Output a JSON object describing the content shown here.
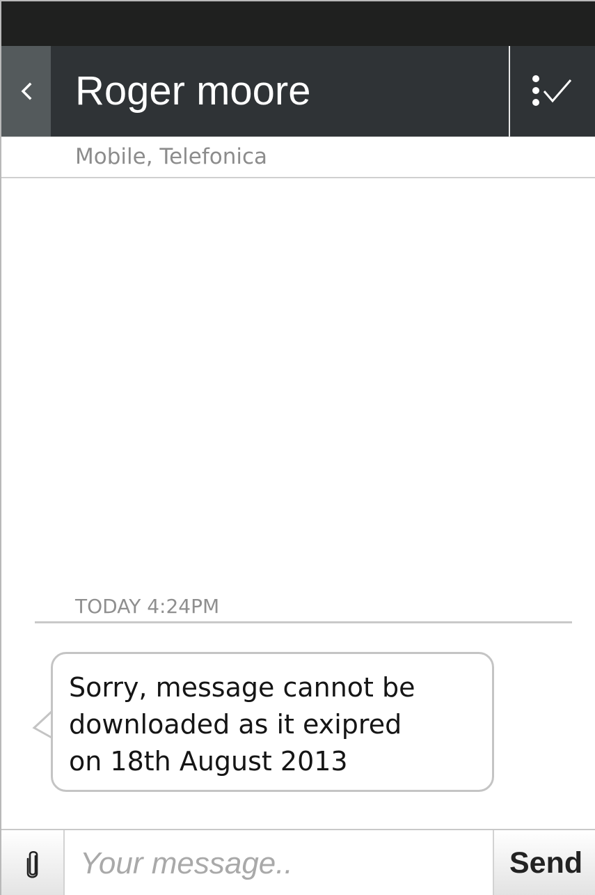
{
  "header": {
    "back_icon": "chevron-left-icon",
    "contact_name": "Roger moore",
    "action_icon": "select-check-icon"
  },
  "subheader": {
    "carrier": "Mobile, Telefonica"
  },
  "thread": {
    "timestamp": "TODAY 4:24PM",
    "messages": [
      {
        "direction": "incoming",
        "text": "Sorry, message cannot be\ndownloaded as it exipred\non 18th August 2013"
      }
    ]
  },
  "composer": {
    "attach_icon": "paperclip-icon",
    "placeholder": "Your message..",
    "value": "",
    "send_label": "Send"
  },
  "colors": {
    "status_bar": "#1f201f",
    "header_bg": "#2f3336",
    "back_button_bg": "#545a5c"
  }
}
